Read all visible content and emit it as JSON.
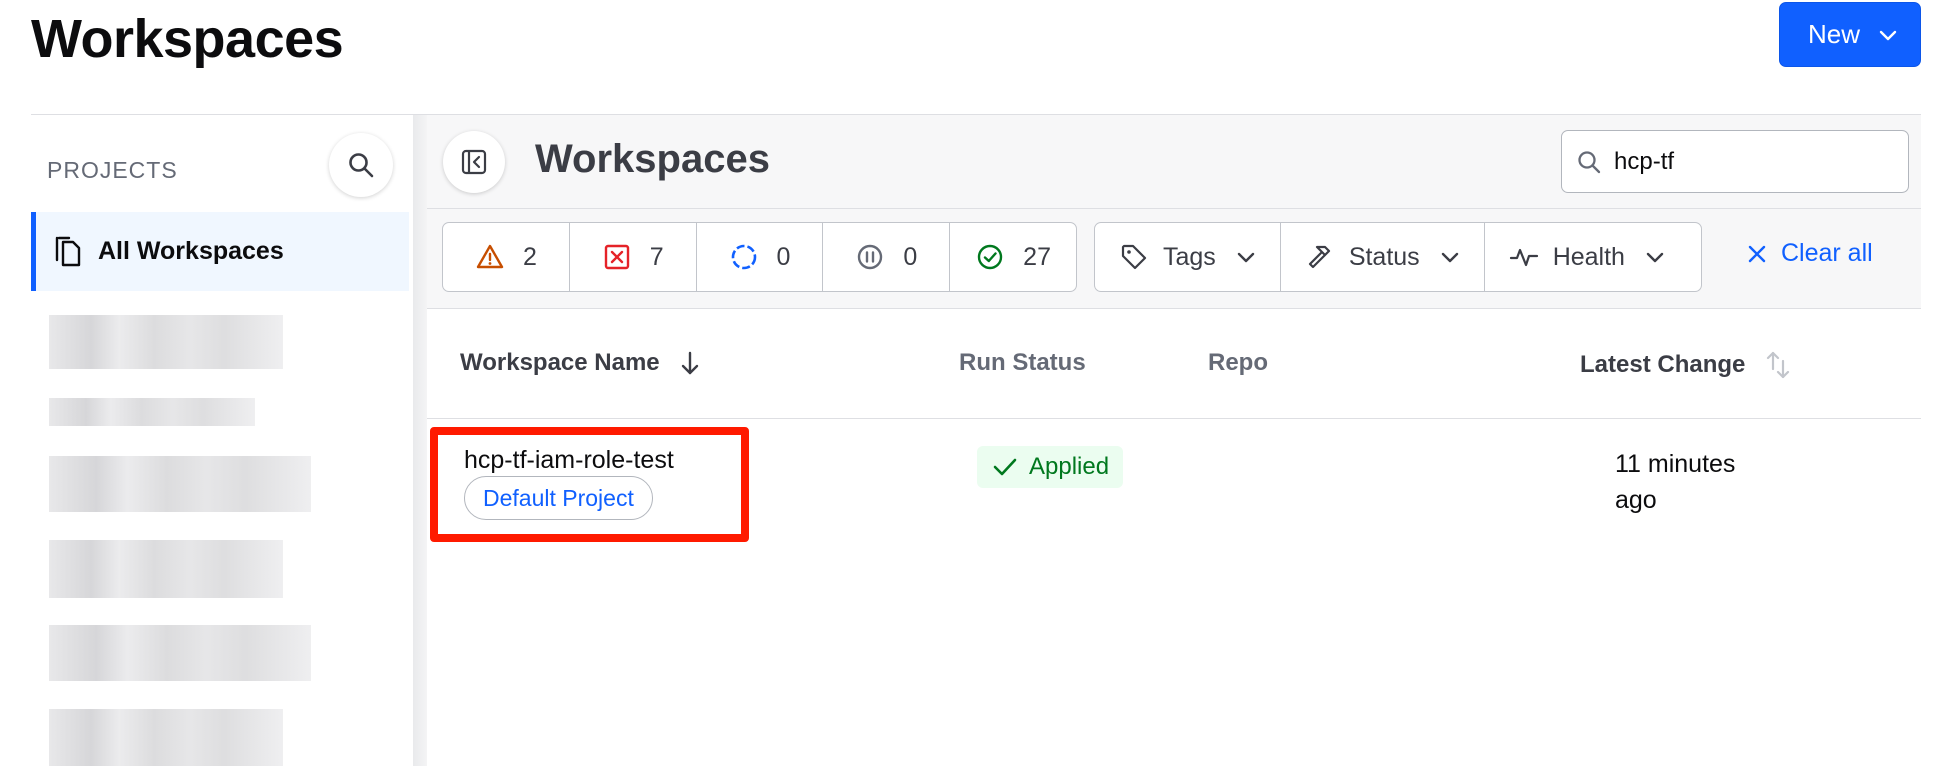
{
  "page": {
    "title": "Workspaces",
    "new_button_label": "New"
  },
  "sidebar": {
    "section_label": "PROJECTS",
    "active_item": "All Workspaces"
  },
  "main": {
    "title": "Workspaces",
    "search": {
      "value": "hcp-tf"
    },
    "counts": [
      {
        "icon": "warning-icon",
        "value": "2",
        "color": "#c74e00"
      },
      {
        "icon": "error-icon",
        "value": "7",
        "color": "#e52228"
      },
      {
        "icon": "running-icon",
        "value": "0",
        "color": "#1060ff"
      },
      {
        "icon": "paused-icon",
        "value": "0",
        "color": "#656a76"
      },
      {
        "icon": "success-icon",
        "value": "27",
        "color": "#00781e"
      }
    ],
    "filters": {
      "tags": "Tags",
      "status": "Status",
      "health": "Health"
    },
    "clear_all": "Clear all",
    "columns": {
      "name": "Workspace Name",
      "run_status": "Run Status",
      "repo": "Repo",
      "latest_change": "Latest Change"
    },
    "rows": [
      {
        "name": "hcp-tf-iam-role-test",
        "project": "Default Project",
        "run_status": "Applied",
        "repo": "",
        "latest_change": "11 minutes ago"
      }
    ]
  },
  "colors": {
    "accent": "#1060ff",
    "highlight": "#ff1a00",
    "success": "#00781e"
  }
}
